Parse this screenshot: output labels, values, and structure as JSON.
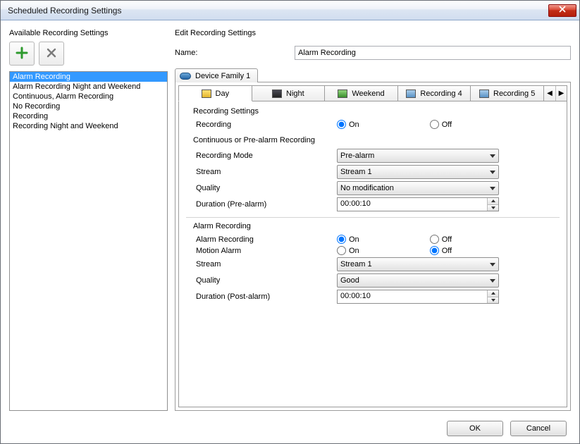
{
  "window": {
    "title": "Scheduled Recording Settings"
  },
  "sidebar": {
    "heading": "Available Recording Settings",
    "items": [
      "Alarm Recording",
      "Alarm Recording Night and Weekend",
      "Continuous, Alarm Recording",
      "No Recording",
      "Recording",
      "Recording Night and Weekend"
    ],
    "selected_index": 0
  },
  "edit": {
    "heading": "Edit Recording Settings",
    "name_label": "Name:",
    "name_value": "Alarm Recording",
    "device_tab": "Device Family 1",
    "rec_tabs": [
      "Day",
      "Night",
      "Weekend",
      "Recording 4",
      "Recording 5"
    ],
    "rec_tab_selected": 0,
    "recording_settings": {
      "group_title": "Recording Settings",
      "recording_label": "Recording",
      "radio_on": "On",
      "radio_off": "Off",
      "recording_value": "On",
      "cont_title": "Continuous or Pre-alarm Recording",
      "mode_label": "Recording Mode",
      "mode_value": "Pre-alarm",
      "stream_label": "Stream",
      "stream_value": "Stream 1",
      "quality_label": "Quality",
      "quality_value": "No modification",
      "duration_label": "Duration (Pre-alarm)",
      "duration_value": "00:00:10"
    },
    "alarm": {
      "group_title": "Alarm Recording",
      "alarm_recording_label": "Alarm Recording",
      "alarm_recording_value": "On",
      "motion_label": "Motion Alarm",
      "motion_value": "Off",
      "radio_on": "On",
      "radio_off": "Off",
      "stream_label": "Stream",
      "stream_value": "Stream 1",
      "quality_label": "Quality",
      "quality_value": "Good",
      "duration_label": "Duration (Post-alarm)",
      "duration_value": "00:00:10"
    }
  },
  "footer": {
    "ok": "OK",
    "cancel": "Cancel"
  }
}
